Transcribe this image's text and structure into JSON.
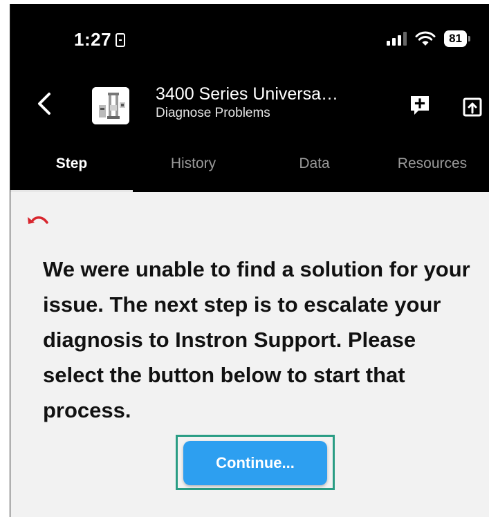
{
  "status_bar": {
    "time": "1:27",
    "battery": "81",
    "icons": [
      "notification-badge-icon",
      "signal-icon",
      "wifi-icon",
      "battery-icon"
    ]
  },
  "app_bar": {
    "title": "3400 Series Universa…",
    "subtitle": "Diagnose Problems",
    "icons": [
      "back-icon",
      "product-thumbnail",
      "add-note-icon",
      "share-icon"
    ]
  },
  "tabs": [
    {
      "label": "Step",
      "active": true
    },
    {
      "label": "History",
      "active": false
    },
    {
      "label": "Data",
      "active": false
    },
    {
      "label": "Resources",
      "active": false
    }
  ],
  "content": {
    "undo_icon": "undo-icon",
    "message": "We were unable to find a solution for your issue. The next step is to escalate your diagnosis to Instron Support. Please select the button below to start that process.",
    "continue_label": "Continue..."
  },
  "colors": {
    "accent_button": "#2d9ff0",
    "highlight_border": "#2a9d84",
    "undo_red": "#d8262e",
    "bar_background": "#000000",
    "content_background": "#f2f2f2"
  }
}
